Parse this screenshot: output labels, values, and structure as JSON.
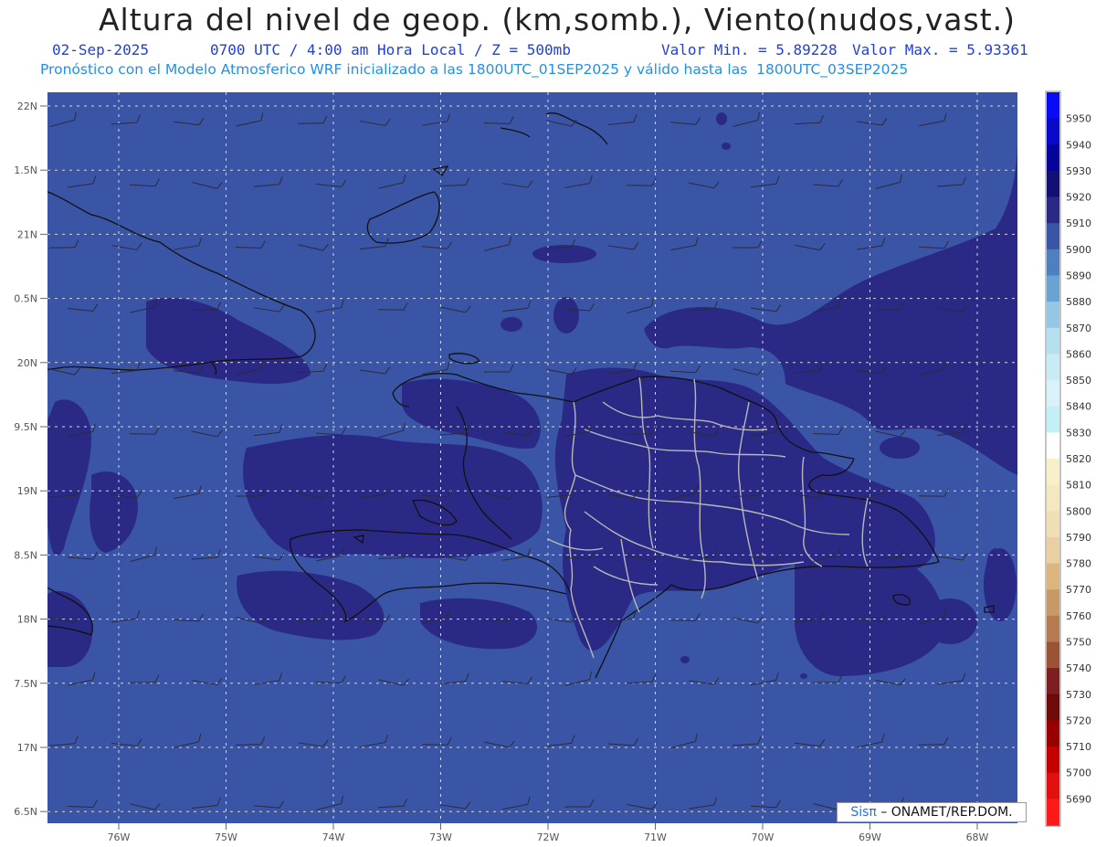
{
  "title": "Altura del nivel de geop. (km,somb.), Viento(nudos,vast.)",
  "subtitle": {
    "date": "02-Sep-2025",
    "time": "0700 UTC / 4:00 am Hora Local / Z = 500mb",
    "min": "Valor Min. = 5.89228",
    "max": "Valor Max. = 5.93361"
  },
  "subtitle2": "Pronóstico con el Modelo Atmosferico WRF inicializado a las 1800UTC_01SEP2025 y válido hasta las  1800UTC_03SEP2025",
  "credit": {
    "brand": "Sisπ",
    "text": " – ONAMET/REP.DOM."
  },
  "map": {
    "lat_labels": [
      "22N",
      "1.5N",
      "21N",
      "0.5N",
      "20N",
      "9.5N",
      "19N",
      "8.5N",
      "18N",
      "7.5N",
      "17N",
      "6.5N"
    ],
    "lon_labels": [
      "76W",
      "75W",
      "74W",
      "73W",
      "72W",
      "71W",
      "70W",
      "69W",
      "68W"
    ],
    "colors": {
      "base": "#3a55a6",
      "high": "#2a2985",
      "coast": "#111111",
      "borders": "#b8b8b8"
    }
  },
  "colorbar": {
    "levels": [
      {
        "label": "5950",
        "color": "#0a0af5"
      },
      {
        "label": "5940",
        "color": "#0808c8"
      },
      {
        "label": "5930",
        "color": "#04049a"
      },
      {
        "label": "5920",
        "color": "#130f73"
      },
      {
        "label": "5910",
        "color": "#2a2985"
      },
      {
        "label": "5900",
        "color": "#3a55a6"
      },
      {
        "label": "5890",
        "color": "#4e7fbf"
      },
      {
        "label": "5880",
        "color": "#6aa3d3"
      },
      {
        "label": "5870",
        "color": "#95c6e4"
      },
      {
        "label": "5860",
        "color": "#b5e0ef"
      },
      {
        "label": "5850",
        "color": "#c9ebf5"
      },
      {
        "label": "5840",
        "color": "#d9f2f9"
      },
      {
        "label": "5830",
        "color": "#c3f0f7"
      },
      {
        "label": "5820",
        "color": "#ffffff"
      },
      {
        "label": "5810",
        "color": "#f8f0c9"
      },
      {
        "label": "5800",
        "color": "#f3e8bf"
      },
      {
        "label": "5790",
        "color": "#efdfb3"
      },
      {
        "label": "5780",
        "color": "#e8d0a2"
      },
      {
        "label": "5770",
        "color": "#dbb47e"
      },
      {
        "label": "5760",
        "color": "#c89867"
      },
      {
        "label": "5750",
        "color": "#b57c52"
      },
      {
        "label": "5740",
        "color": "#9c5236"
      },
      {
        "label": "5730",
        "color": "#7c1e22"
      },
      {
        "label": "5720",
        "color": "#6e0a0a"
      },
      {
        "label": "5710",
        "color": "#990000"
      },
      {
        "label": "5700",
        "color": "#c40000"
      },
      {
        "label": "5690",
        "color": "#e31010"
      },
      {
        "label": "",
        "color": "#ff1a1a"
      }
    ]
  }
}
